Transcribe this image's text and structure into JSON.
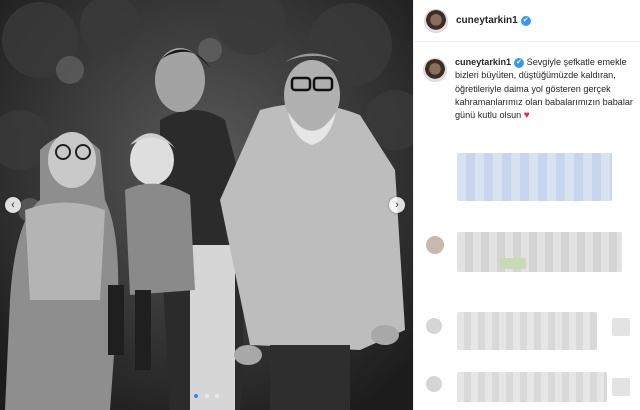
{
  "post": {
    "username": "cuneytarkin1",
    "caption": "Sevgiyle şefkatle emekle bizleri büyüten, düştüğümüzde kaldıran, öğretileriyle daima yol gösteren gerçek kahramanlarımız olan babalarımızın babalar günü kutlu olsun",
    "heart": "♥"
  },
  "carousel": {
    "prev_icon": "‹",
    "next_icon": "›",
    "slide_count": 3,
    "active_slide": 1
  },
  "icons": {
    "verified": "✔",
    "verified_color": "#3897f0",
    "heart_color": "#e0245e",
    "active_dot_color": "#2f8cf0"
  }
}
